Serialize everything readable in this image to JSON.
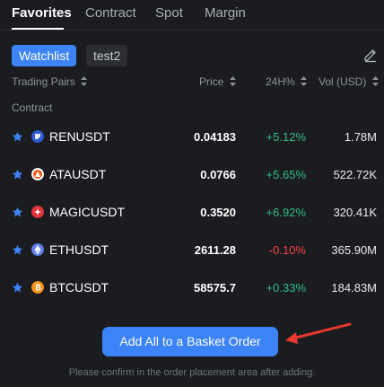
{
  "tabs": [
    {
      "label": "Favorites",
      "active": true
    },
    {
      "label": "Contract",
      "active": false
    },
    {
      "label": "Spot",
      "active": false
    },
    {
      "label": "Margin",
      "active": false
    }
  ],
  "groups": [
    {
      "label": "Watchlist",
      "active": true
    },
    {
      "label": "test2",
      "active": false
    }
  ],
  "edit_icon": "pencil-icon",
  "headers": {
    "pairs": "Trading Pairs",
    "price": "Price",
    "change": "24H%",
    "vol": "Vol (USD)"
  },
  "section_label": "Contract",
  "rows": [
    {
      "pair": "RENUSDT",
      "price": "0.04183",
      "change": "+5.12%",
      "direction": "up",
      "vol": "1.78M",
      "coin_icon": "ren-coin-icon",
      "coin_color": "#2f5bd6"
    },
    {
      "pair": "ATAUSDT",
      "price": "0.0766",
      "change": "+5.65%",
      "direction": "up",
      "vol": "522.72K",
      "coin_icon": "ata-coin-icon",
      "coin_color": "#f05a1a"
    },
    {
      "pair": "MAGICUSDT",
      "price": "0.3520",
      "change": "+6.92%",
      "direction": "up",
      "vol": "320.41K",
      "coin_icon": "magic-coin-icon",
      "coin_color": "#e0343c"
    },
    {
      "pair": "ETHUSDT",
      "price": "2611.28",
      "change": "-0.10%",
      "direction": "down",
      "vol": "365.90M",
      "coin_icon": "eth-coin-icon",
      "coin_color": "#627eea"
    },
    {
      "pair": "BTCUSDT",
      "price": "58575.7",
      "change": "+0.33%",
      "direction": "up",
      "vol": "184.83M",
      "coin_icon": "btc-coin-icon",
      "coin_color": "#f7931a"
    }
  ],
  "basket_button": "Add All to a Basket Order",
  "footnote": "Please confirm in the order placement area after adding.",
  "colors": {
    "accent": "#3b83f6",
    "up": "#2fbd85",
    "down": "#f0454a",
    "annotation_arrow": "#e8372c"
  }
}
